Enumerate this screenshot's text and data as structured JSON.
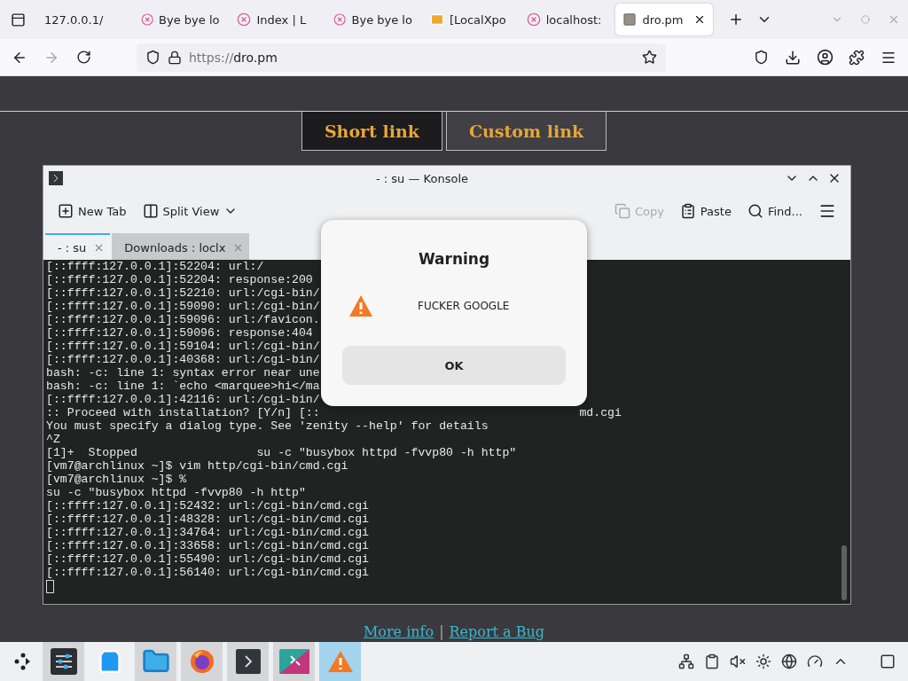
{
  "browser": {
    "tabs": [
      {
        "label": "127.0.0.1/",
        "kind": "plain",
        "selected": false
      },
      {
        "label": "Bye bye lo",
        "kind": "blocked",
        "selected": false
      },
      {
        "label": "Index | L",
        "kind": "blocked",
        "selected": false
      },
      {
        "label": "Bye bye lo",
        "kind": "blocked",
        "selected": false
      },
      {
        "label": "[LocalXpo",
        "kind": "mail",
        "selected": false
      },
      {
        "label": "localhost:",
        "kind": "blocked",
        "selected": false
      },
      {
        "label": "dro.pm",
        "kind": "site",
        "selected": true
      }
    ],
    "forward_disabled": true,
    "address": {
      "scheme": "https://",
      "host": "dro.pm"
    }
  },
  "page": {
    "modes": [
      {
        "label": "Short link",
        "selected": true
      },
      {
        "label": "Custom link",
        "selected": false
      }
    ],
    "footer_links": [
      "More info",
      "Report a Bug"
    ],
    "footer_separator": "|"
  },
  "konsole": {
    "title": "- : su — Konsole",
    "toolbar": [
      {
        "kind": "newtab",
        "label": "New Tab",
        "disabled": false
      },
      {
        "kind": "split",
        "label": "Split View",
        "disabled": false
      },
      {
        "kind": "copy",
        "label": "Copy",
        "disabled": true
      },
      {
        "kind": "paste",
        "label": "Paste",
        "disabled": false
      },
      {
        "kind": "find",
        "label": "Find...",
        "disabled": false
      }
    ],
    "tabs": [
      {
        "label": "- : su",
        "selected": true
      },
      {
        "label": "Downloads : loclx",
        "selected": false
      }
    ],
    "lines": [
      {
        "text": "[::ffff:127.0.0.1]:52204: url:/"
      },
      {
        "text": "[::ffff:127.0.0.1]:52204: response:200"
      },
      {
        "text": "[::ffff:127.0.0.1]:52210: url:/cgi-bin/"
      },
      {
        "text": "[::ffff:127.0.0.1]:59090: url:/cgi-bin/"
      },
      {
        "text": "[::ffff:127.0.0.1]:59096: url:/favicon."
      },
      {
        "text": "[::ffff:127.0.0.1]:59096: response:404"
      },
      {
        "text": "[::ffff:127.0.0.1]:59104: url:/cgi-bin/"
      },
      {
        "text": "[::ffff:127.0.0.1]:40368: url:/cgi-bin/"
      },
      {
        "text": "bash: -c: line 1: syntax error near une"
      },
      {
        "text": "bash: -c: line 1: `echo <marquee>hi</ma"
      },
      {
        "text": "[::ffff:127.0.0.1]:42116: url:/cgi-bin/"
      },
      {
        "text": ":: Proceed with installation? [Y/n] [::",
        "tail": "md.cgi"
      },
      {
        "text": "You must specify a dialog type. See 'zenity --help' for details"
      },
      {
        "text": "^Z"
      },
      {
        "text": "[1]+  Stopped                 su -c \"busybox httpd -fvvp80 -h http\""
      },
      {
        "text": "[vm7@archlinux ~]$ vim http/cgi-bin/cmd.cgi"
      },
      {
        "text": "[vm7@archlinux ~]$ %"
      },
      {
        "text": "su -c \"busybox httpd -fvvp80 -h http\""
      },
      {
        "text": "[::ffff:127.0.0.1]:52432: url:/cgi-bin/cmd.cgi"
      },
      {
        "text": "[::ffff:127.0.0.1]:48328: url:/cgi-bin/cmd.cgi"
      },
      {
        "text": "[::ffff:127.0.0.1]:34764: url:/cgi-bin/cmd.cgi"
      },
      {
        "text": "[::ffff:127.0.0.1]:33658: url:/cgi-bin/cmd.cgi"
      },
      {
        "text": "[::ffff:127.0.0.1]:55490: url:/cgi-bin/cmd.cgi"
      },
      {
        "text": "[::ffff:127.0.0.1]:56140: url:/cgi-bin/cmd.cgi"
      }
    ]
  },
  "dialog": {
    "title": "Warning",
    "message": "FUCKER GOOGLE",
    "button": "OK"
  },
  "taskbar": {
    "items": [
      {
        "kind": "settings",
        "open": true,
        "selected": false
      },
      {
        "kind": "store",
        "open": false,
        "selected": false
      },
      {
        "kind": "files",
        "open": true,
        "selected": false
      },
      {
        "kind": "browser",
        "open": true,
        "selected": false
      },
      {
        "kind": "terminal",
        "open": true,
        "selected": false
      },
      {
        "kind": "app",
        "open": true,
        "selected": false
      },
      {
        "kind": "warning",
        "open": true,
        "selected": true
      }
    ]
  }
}
